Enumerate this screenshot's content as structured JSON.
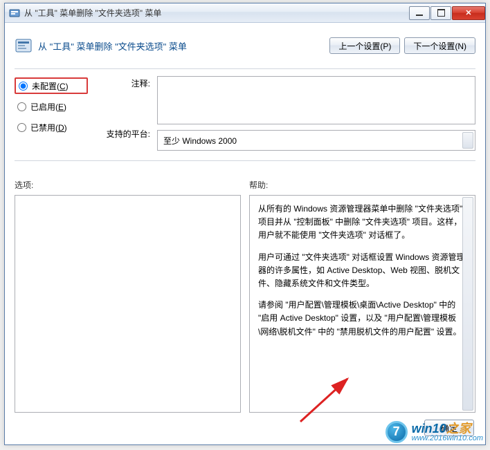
{
  "titlebar": {
    "text": "从 \"工具\" 菜单删除 \"文件夹选项\" 菜单"
  },
  "header": {
    "title": "从 \"工具\" 菜单删除 \"文件夹选项\" 菜单",
    "prev_label": "上一个设置(P)",
    "next_label": "下一个设置(N)"
  },
  "radios": {
    "not_configured": {
      "label": "未配置(",
      "hotkey": "C",
      "suffix": ")"
    },
    "enabled": {
      "label": "已启用(",
      "hotkey": "E",
      "suffix": ")"
    },
    "disabled": {
      "label": "已禁用(",
      "hotkey": "D",
      "suffix": ")"
    }
  },
  "labels": {
    "notes": "注释:",
    "platform": "支持的平台:",
    "options": "选项:",
    "help": "帮助:"
  },
  "platform_text": "至少 Windows 2000",
  "notes_value": "",
  "help_paragraphs": [
    "从所有的 Windows 资源管理器菜单中删除 \"文件夹选项\" 项目并从 \"控制面板\" 中删除 \"文件夹选项\" 项目。这样，用户就不能使用 \"文件夹选项\" 对话框了。",
    "用户可通过 \"文件夹选项\" 对话框设置 Windows 资源管理器的许多属性，如 Active Desktop、Web 视图、脱机文件、隐藏系统文件和文件类型。",
    "请参阅 \"用户配置\\管理模板\\桌面\\Active Desktop\" 中的 \"启用 Active Desktop\" 设置，以及 \"用户配置\\管理模板\\网络\\脱机文件\" 中的 \"禁用脱机文件的用户配置\" 设置。"
  ],
  "footer": {
    "ok_label": "确定"
  },
  "watermark": {
    "brand": "win10",
    "suffix": "之家",
    "url": "www.2016win10.com"
  }
}
